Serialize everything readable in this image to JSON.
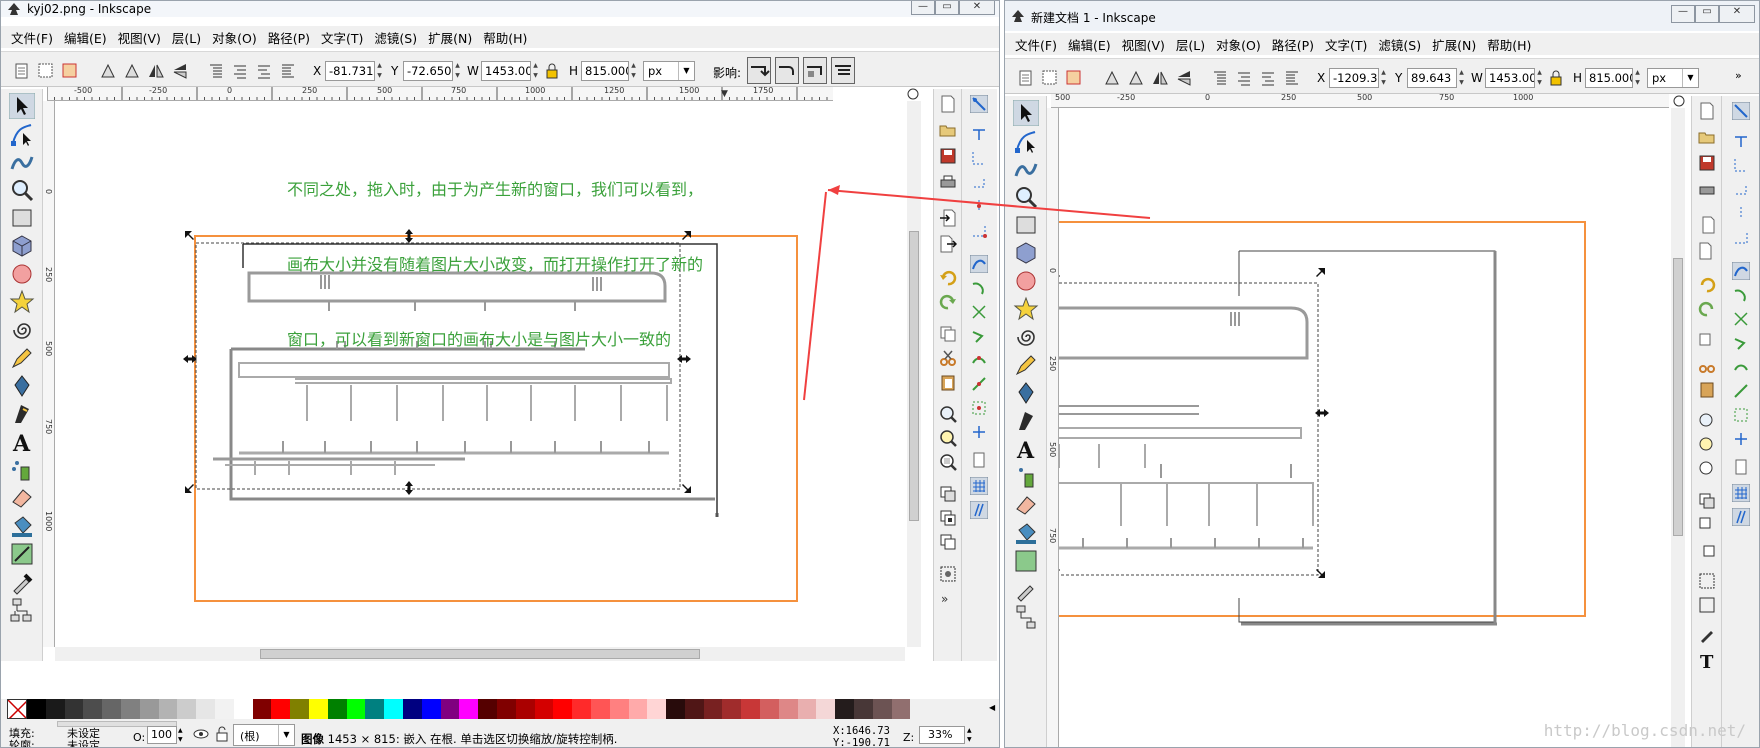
{
  "left_window": {
    "title": "kyj02.png - Inkscape",
    "menu": [
      "文件(F)",
      "编辑(E)",
      "视图(V)",
      "层(L)",
      "对象(O)",
      "路径(P)",
      "文字(T)",
      "滤镜(S)",
      "扩展(N)",
      "帮助(H)"
    ],
    "controls": {
      "x_label": "X",
      "x": "-81.731",
      "y_label": "Y",
      "y": "-72.650",
      "w_label": "W",
      "w": "1453.00",
      "h_label": "H",
      "h": "815.000",
      "unit": "px",
      "affect_label": "影响:"
    },
    "ruler_ticks": [
      "-500",
      "-250",
      "0",
      "250",
      "500",
      "750",
      "1000",
      "1250",
      "1500",
      "1750"
    ],
    "vruler_ticks": [
      "0",
      "250",
      "500",
      "750",
      "1000"
    ],
    "annotation": [
      "不同之处，拖入时，由于为产生新的窗口，我们可以看到，",
      "画布大小并没有随着图片大小改变，而打开操作打开了新的",
      "窗口，可以看到新窗口的画布大小是与图片大小一致的"
    ],
    "status": {
      "fill_label": "填充:",
      "fill_value": "未设定",
      "stroke_label": "轮廓:",
      "stroke_value": "未设定",
      "opacity_label": "O:",
      "opacity_value": "100",
      "layer_value": "(根)",
      "message_bold": "图像",
      "message": " 1453 × 815: 嵌入 在根. 单击选区切换缩放/旋转控制柄.",
      "cursor_x": "X:1646.73",
      "cursor_y": "Y:-190.71",
      "zoom_label": "Z:",
      "zoom_value": "33%"
    }
  },
  "right_window": {
    "title": "新建文档 1 - Inkscape",
    "menu": [
      "文件(F)",
      "编辑(E)",
      "视图(V)",
      "层(L)",
      "对象(O)",
      "路径(P)",
      "文字(T)",
      "滤镜(S)",
      "扩展(N)",
      "帮助(H)"
    ],
    "controls": {
      "x_label": "X",
      "x": "-1209.3",
      "y_label": "Y",
      "y": "89.643",
      "w_label": "W",
      "w": "1453.00",
      "h_label": "H",
      "h": "815.000",
      "unit": "px"
    },
    "ruler_ticks": [
      "500",
      "-250",
      "0",
      "250",
      "500",
      "750",
      "1000"
    ],
    "vruler_ticks": [
      "0",
      "250",
      "500",
      "750"
    ]
  },
  "watermark": "http://blog.csdn.net/",
  "colors": {
    "orange_frame": "#f5913e",
    "arrow": "#f04040",
    "annotation": "#3ba13b",
    "palette": [
      "#000000",
      "#1a1a1a",
      "#333333",
      "#4d4d4d",
      "#666666",
      "#808080",
      "#999999",
      "#b3b3b3",
      "#cccccc",
      "#e6e6e6",
      "#f2f2f2",
      "#ffffff",
      "#800000",
      "#ff0000",
      "#808000",
      "#ffff00",
      "#008000",
      "#00ff00",
      "#008080",
      "#00ffff",
      "#000080",
      "#0000ff",
      "#800080",
      "#ff00ff",
      "#550000",
      "#800000",
      "#aa0000",
      "#d40000",
      "#ff0000",
      "#ff2a2a",
      "#ff5555",
      "#ff8080",
      "#ffaaaa",
      "#ffd5d5",
      "#280b0b",
      "#501616",
      "#782121",
      "#a02c2c",
      "#c83737",
      "#d35f5f",
      "#de8787",
      "#e9afaf",
      "#f4d7d7",
      "#241c1c",
      "#483737",
      "#6c5353",
      "#916f6f"
    ]
  }
}
